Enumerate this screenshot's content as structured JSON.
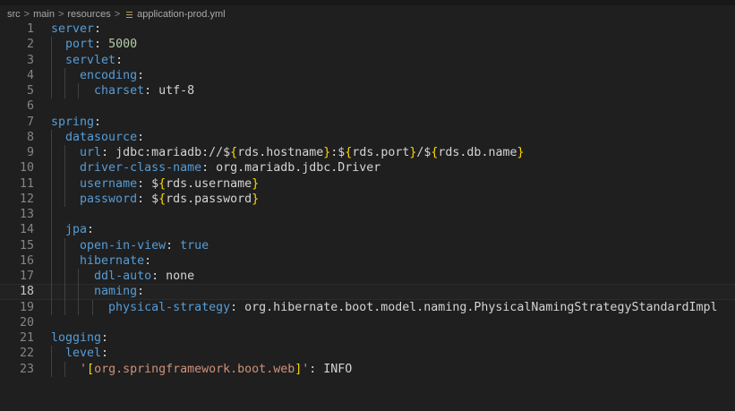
{
  "breadcrumb": {
    "items": [
      "src",
      "main",
      "resources",
      "application-prod.yml"
    ],
    "separator": ">"
  },
  "editor": {
    "current_line": 18,
    "lines": [
      {
        "n": "1",
        "indent": 0,
        "k": "server",
        "rest": []
      },
      {
        "n": "2",
        "indent": 1,
        "k": "port",
        "rest": [
          {
            "t": " "
          },
          {
            "t": "5000",
            "c": "num"
          }
        ]
      },
      {
        "n": "3",
        "indent": 1,
        "k": "servlet",
        "rest": []
      },
      {
        "n": "4",
        "indent": 2,
        "k": "encoding",
        "rest": []
      },
      {
        "n": "5",
        "indent": 3,
        "k": "charset",
        "rest": [
          {
            "t": " utf-8"
          }
        ]
      },
      {
        "n": "6",
        "indent": 0,
        "rest": []
      },
      {
        "n": "7",
        "indent": 0,
        "k": "spring",
        "rest": []
      },
      {
        "n": "8",
        "indent": 1,
        "k": "datasource",
        "rest": []
      },
      {
        "n": "9",
        "indent": 2,
        "k": "url",
        "rest": [
          {
            "t": " jdbc:mariadb://$"
          },
          {
            "t": "{",
            "c": "brace"
          },
          {
            "t": "rds.hostname"
          },
          {
            "t": "}",
            "c": "brace"
          },
          {
            "t": ":$"
          },
          {
            "t": "{",
            "c": "brace"
          },
          {
            "t": "rds.port"
          },
          {
            "t": "}",
            "c": "brace"
          },
          {
            "t": "/$"
          },
          {
            "t": "{",
            "c": "brace"
          },
          {
            "t": "rds.db.name"
          },
          {
            "t": "}",
            "c": "brace"
          }
        ]
      },
      {
        "n": "10",
        "indent": 2,
        "k": "driver-class-name",
        "rest": [
          {
            "t": " org.mariadb.jdbc.Driver"
          }
        ]
      },
      {
        "n": "11",
        "indent": 2,
        "k": "username",
        "rest": [
          {
            "t": " $"
          },
          {
            "t": "{",
            "c": "brace"
          },
          {
            "t": "rds.username"
          },
          {
            "t": "}",
            "c": "brace"
          }
        ]
      },
      {
        "n": "12",
        "indent": 2,
        "k": "password",
        "rest": [
          {
            "t": " $"
          },
          {
            "t": "{",
            "c": "brace"
          },
          {
            "t": "rds.password"
          },
          {
            "t": "}",
            "c": "brace"
          }
        ]
      },
      {
        "n": "13",
        "indent": 1,
        "rest": []
      },
      {
        "n": "14",
        "indent": 1,
        "k": "jpa",
        "rest": []
      },
      {
        "n": "15",
        "indent": 2,
        "k": "open-in-view",
        "rest": [
          {
            "t": " "
          },
          {
            "t": "true",
            "c": "bool"
          }
        ]
      },
      {
        "n": "16",
        "indent": 2,
        "k": "hibernate",
        "rest": []
      },
      {
        "n": "17",
        "indent": 3,
        "k": "ddl-auto",
        "rest": [
          {
            "t": " none"
          }
        ]
      },
      {
        "n": "18",
        "indent": 3,
        "k": "naming",
        "rest": []
      },
      {
        "n": "19",
        "indent": 4,
        "k": "physical-strategy",
        "rest": [
          {
            "t": " org.hibernate.boot.model.naming.PhysicalNamingStrategyStandardImpl"
          }
        ]
      },
      {
        "n": "20",
        "indent": 0,
        "rest": []
      },
      {
        "n": "21",
        "indent": 0,
        "k": "logging",
        "rest": []
      },
      {
        "n": "22",
        "indent": 1,
        "k": "level",
        "rest": []
      },
      {
        "n": "23",
        "indent": 2,
        "k": "'",
        "kc": "str",
        "rest": [
          {
            "t": "[",
            "c": "brace"
          },
          {
            "t": "org.springframework.boot.web",
            "c": "str"
          },
          {
            "t": "]",
            "c": "brace"
          },
          {
            "t": "'",
            "c": "str"
          },
          {
            "t": ":"
          },
          {
            "t": " INFO"
          }
        ]
      }
    ]
  }
}
